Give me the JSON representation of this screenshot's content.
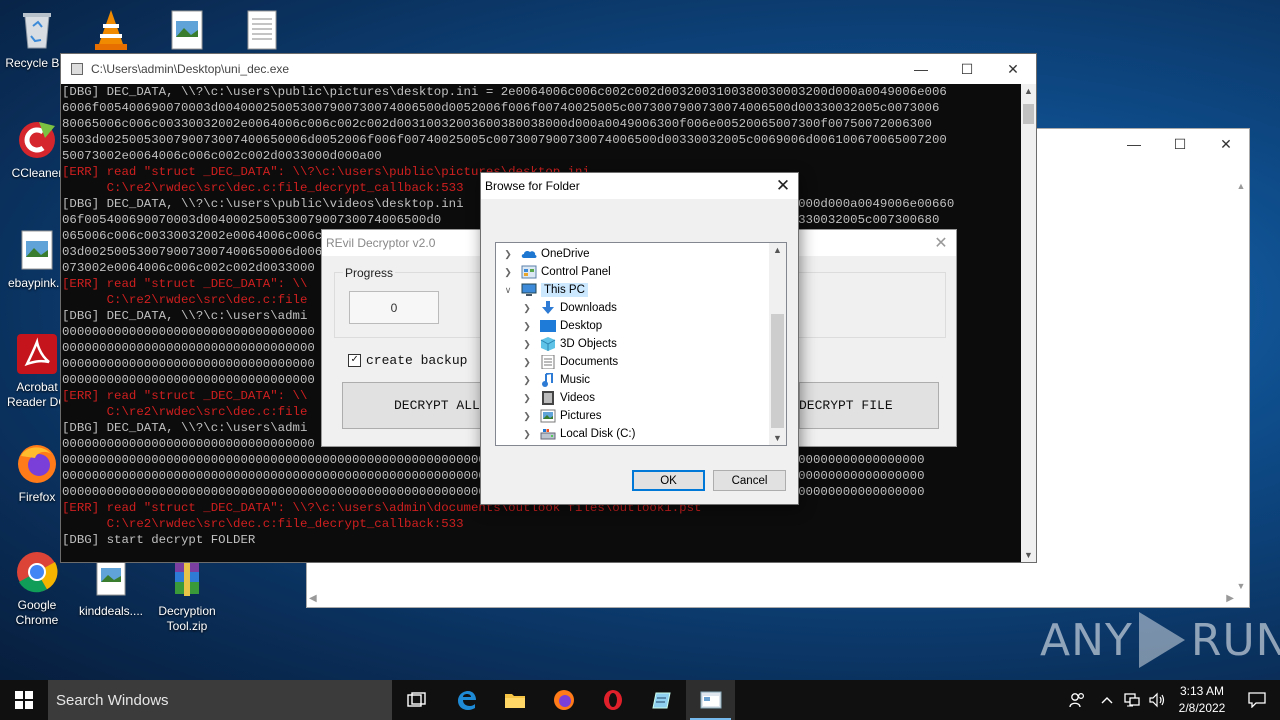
{
  "desktop": {
    "icons": [
      {
        "label": "Recycle Bin"
      },
      {
        "label": "CCleaner"
      },
      {
        "label": "ebaypink..."
      },
      {
        "label": "Acrobat Reader DC"
      },
      {
        "label": "Firefox"
      },
      {
        "label": "Google Chrome"
      },
      {
        "label": "kinddeals...."
      },
      {
        "label": "Decryption Tool.zip"
      }
    ]
  },
  "console": {
    "title": "C:\\Users\\admin\\Desktop\\uni_dec.exe",
    "lines": [
      {
        "type": "dbg",
        "text": "[DBG] DEC_DATA, \\\\?\\c:\\users\\public\\pictures\\desktop.ini = 2e0064006c006c002c002d0032003100380030003200d000a0049006e006"
      },
      {
        "type": "dbg",
        "text": "6006f005400690070003d004000250053007900730074006500d0052006f006f00740025005c0073007900730074006500d00330032005c0073006"
      },
      {
        "type": "dbg",
        "text": "80065006c006c00330032002e0064006c006c002c002d00310032003600380038000d000a0049006300f006e00520065007300f00750072006300"
      },
      {
        "type": "dbg",
        "text": "5003d0025005300790073007400650006d0052006f006f00740025005c0073007900730074006500d00330032005c0069006d006100670065007200"
      },
      {
        "type": "dbg",
        "text": "50073002e0064006c006c002c002d0033000d000a00"
      },
      {
        "type": "err",
        "text": "[ERR] read \"struct _DEC_DATA\": \\\\?\\c:\\users\\public\\pictures\\desktop.ini"
      },
      {
        "type": "err",
        "text": "      C:\\re2\\rwdec\\src\\dec.c:file_decrypt_callback:533"
      },
      {
        "type": "dbg",
        "text": "[DBG] DEC_DATA, \\\\?\\c:\\users\\public\\videos\\desktop.ini                                      0300034000d000a0049006e00660"
      },
      {
        "type": "dbg",
        "text": "06f005400690070003d004000250053007900730074006500d0                                       065006d00330032005c007300680"
      },
      {
        "type": "dbg",
        "text": "065006c006c00330032002e0064006c006c                                                                          06300650"
      },
      {
        "type": "dbg",
        "text": "03d0025005300790073007400650006d006                                                                          07200650"
      },
      {
        "type": "dbg",
        "text": "073002e0064006c006c002c002d0033000"
      },
      {
        "type": "err",
        "text": "[ERR] read \"struct _DEC_DATA\": \\\\"
      },
      {
        "type": "err",
        "text": "      C:\\re2\\rwdec\\src\\dec.c:file"
      },
      {
        "type": "dbg",
        "text": "[DBG] DEC_DATA, \\\\?\\c:\\users\\admi                                                                          000000000"
      },
      {
        "type": "dbg",
        "text": "0000000000000000000000000000000000                                                                          000000000"
      },
      {
        "type": "dbg",
        "text": "0000000000000000000000000000000000                                                                          000000000"
      },
      {
        "type": "dbg",
        "text": "0000000000000000000000000000000000                                                                          000000000"
      },
      {
        "type": "dbg",
        "text": "0000000000000000000000000000000000"
      },
      {
        "type": "err",
        "text": "[ERR] read \"struct _DEC_DATA\": \\\\"
      },
      {
        "type": "err",
        "text": "      C:\\re2\\rwdec\\src\\dec.c:file"
      },
      {
        "type": "dbg",
        "text": "[DBG] DEC_DATA, \\\\?\\c:\\users\\admi                                                                          000000000"
      },
      {
        "type": "dbg",
        "text": "0000000000000000000000000000000000                                                                          000000000"
      },
      {
        "type": "dbg",
        "text": "00000000000000000000000000000000000000000000000000000000000000000000000000000000000000000000000000000000000000000000"
      },
      {
        "type": "dbg",
        "text": "00000000000000000000000000000000000000000000000000000000000000000000000000000000000000000000000000000000000000000000"
      },
      {
        "type": "dbg",
        "text": "00000000000000000000000000000000000000000000000000000000000000000000000000000000000000000000000000000000000000000000"
      },
      {
        "type": "err",
        "text": "[ERR] read \"struct _DEC_DATA\": \\\\?\\c:\\users\\admin\\documents\\outlook files\\outlook1.pst"
      },
      {
        "type": "err",
        "text": "      C:\\re2\\rwdec\\src\\dec.c:file_decrypt_callback:533"
      },
      {
        "type": "dbg",
        "text": "[DBG] start decrypt FOLDER"
      }
    ]
  },
  "revil": {
    "title": "REvil Decryptor v2.0",
    "progress_label": "Progress",
    "progress_value": "0",
    "checkbox_label": "create backup",
    "checkbox_checked": true,
    "decrypt_all_label": "DECRYPT ALL",
    "decrypt_file_label": "DECRYPT FILE"
  },
  "browse": {
    "title": "Browse for Folder",
    "tree": [
      {
        "label": "OneDrive",
        "level": 0,
        "expanded": false,
        "icon": "onedrive-icon"
      },
      {
        "label": "Control Panel",
        "level": 0,
        "expanded": false,
        "icon": "control-panel-icon"
      },
      {
        "label": "This PC",
        "level": 0,
        "expanded": true,
        "selected": true,
        "icon": "this-pc-icon"
      },
      {
        "label": "Downloads",
        "level": 1,
        "icon": "downloads-icon"
      },
      {
        "label": "Desktop",
        "level": 1,
        "icon": "desktop-folder-icon"
      },
      {
        "label": "3D Objects",
        "level": 1,
        "icon": "3d-objects-icon"
      },
      {
        "label": "Documents",
        "level": 1,
        "icon": "documents-icon"
      },
      {
        "label": "Music",
        "level": 1,
        "icon": "music-icon"
      },
      {
        "label": "Videos",
        "level": 1,
        "icon": "videos-icon"
      },
      {
        "label": "Pictures",
        "level": 1,
        "icon": "pictures-icon"
      },
      {
        "label": "Local Disk (C:)",
        "level": 1,
        "icon": "local-disk-icon"
      }
    ],
    "ok_label": "OK",
    "cancel_label": "Cancel"
  },
  "watermark": {
    "left": "ANY",
    "right": "RUN"
  },
  "taskbar": {
    "search_placeholder": "Search Windows",
    "time": "3:13 AM",
    "date": "2/8/2022"
  },
  "colors": {
    "console_bg": "#0c0c0c",
    "console_err": "#d01f1f",
    "selection": "#cce8ff",
    "accent": "#0078d7"
  }
}
